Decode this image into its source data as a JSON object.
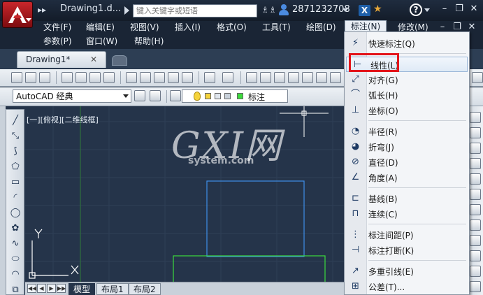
{
  "titlebar": {
    "qat_glyph": "▸▸",
    "document": "Drawing1.d...",
    "search_placeholder": "键入关键字或短语",
    "binoculars_glyph": "♗♗",
    "user_id": "2871232708",
    "exchange_glyph": "X",
    "star_glyph": "★",
    "help_glyph": "?",
    "minimize_glyph": "–",
    "restore_glyph": "❐",
    "close_glyph": "✕"
  },
  "menubar": {
    "row1": [
      "文件(F)",
      "编辑(E)",
      "视图(V)",
      "插入(I)",
      "格式(O)",
      "工具(T)",
      "绘图(D)",
      "标注(N)",
      "修改(M)"
    ],
    "row2": [
      "参数(P)",
      "窗口(W)",
      "帮助(H)"
    ],
    "active": "标注(N)",
    "doc_minimize": "–",
    "doc_restore": "❐",
    "doc_close": "✕"
  },
  "tabs": {
    "active_tab": "Drawing1*",
    "close_glyph": "✕"
  },
  "toolbar": {
    "workspace": "AutoCAD 经典",
    "layer": "标注"
  },
  "viewport": {
    "label": "[一][俯视][二维线框]",
    "y_axis": "Y",
    "x_axis": "X"
  },
  "layout_tabs": [
    "模型",
    "布局1",
    "布局2"
  ],
  "layout_nav": [
    "◀◀",
    "◀",
    "▶",
    "▶▶"
  ],
  "dropdown_items": [
    {
      "label": "快速标注(Q)",
      "icon": "quick-dimension-icon",
      "glyph": "⚡"
    },
    {
      "label": "线性(L)",
      "icon": "linear-dimension-icon",
      "glyph": "⊢"
    },
    {
      "label": "对齐(G)",
      "icon": "aligned-dimension-icon",
      "glyph": "⤢"
    },
    {
      "label": "弧长(H)",
      "icon": "arc-length-icon",
      "glyph": "⌒"
    },
    {
      "label": "坐标(O)",
      "icon": "ordinate-icon",
      "glyph": "⊥"
    },
    {
      "label": "半径(R)",
      "icon": "radius-icon",
      "glyph": "◔"
    },
    {
      "label": "折弯(J)",
      "icon": "jogged-icon",
      "glyph": "◕"
    },
    {
      "label": "直径(D)",
      "icon": "diameter-icon",
      "glyph": "⊘"
    },
    {
      "label": "角度(A)",
      "icon": "angular-icon",
      "glyph": "∠"
    },
    {
      "label": "基线(B)",
      "icon": "baseline-icon",
      "glyph": "⊏"
    },
    {
      "label": "连续(C)",
      "icon": "continue-icon",
      "glyph": "⊓"
    },
    {
      "label": "标注间距(P)",
      "icon": "dim-space-icon",
      "glyph": "⋮"
    },
    {
      "label": "标注打断(K)",
      "icon": "dim-break-icon",
      "glyph": "⊣"
    },
    {
      "label": "多重引线(E)",
      "icon": "multileader-icon",
      "glyph": "↗"
    },
    {
      "label": "公差(T)...",
      "icon": "tolerance-icon",
      "glyph": "⊞"
    }
  ],
  "draw_tools": [
    {
      "name": "line-icon",
      "glyph": "╱"
    },
    {
      "name": "construction-line-icon",
      "glyph": "⤡"
    },
    {
      "name": "polyline-icon",
      "glyph": "⟆"
    },
    {
      "name": "polygon-icon",
      "glyph": "⬠"
    },
    {
      "name": "rectangle-icon",
      "glyph": "▭"
    },
    {
      "name": "arc-icon",
      "glyph": "◜"
    },
    {
      "name": "circle-icon",
      "glyph": "◯"
    },
    {
      "name": "revision-cloud-icon",
      "glyph": "✿"
    },
    {
      "name": "spline-icon",
      "glyph": "∿"
    },
    {
      "name": "ellipse-icon",
      "glyph": "⬭"
    },
    {
      "name": "ellipse-arc-icon",
      "glyph": "◠"
    },
    {
      "name": "insert-block-icon",
      "glyph": "⧉"
    }
  ],
  "watermark": {
    "main": "GXI网",
    "sub": "system.com"
  },
  "colors": {
    "canvas": "#25344a",
    "accent_red": "#e3151b",
    "blue_geometry": "#3f8fe8",
    "green_geometry": "#3cdb3c"
  }
}
